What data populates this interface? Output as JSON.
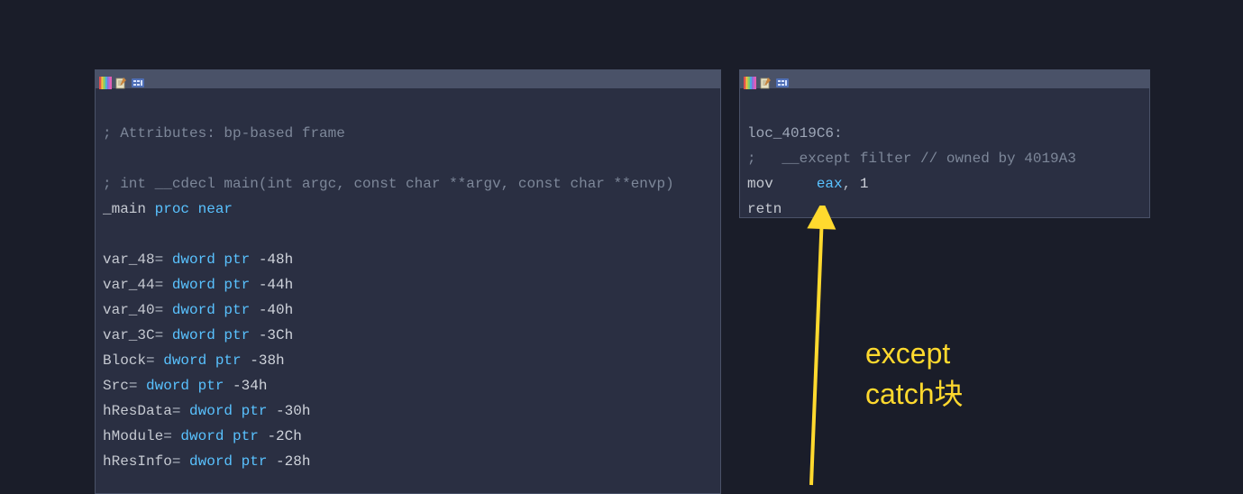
{
  "left_panel": {
    "lines": [
      [
        {
          "cls": "c-plain",
          "t": ""
        }
      ],
      [
        {
          "cls": "c-comment",
          "t": "; Attributes: bp-based frame"
        }
      ],
      [
        {
          "cls": "c-plain",
          "t": ""
        }
      ],
      [
        {
          "cls": "c-comment",
          "t": "; int __cdecl main(int argc, const char **argv, const char **envp)"
        }
      ],
      [
        {
          "cls": "c-id",
          "t": "_main "
        },
        {
          "cls": "c-type",
          "t": "proc near"
        }
      ],
      [
        {
          "cls": "c-plain",
          "t": ""
        }
      ],
      [
        {
          "cls": "c-id",
          "t": "var_48"
        },
        {
          "cls": "c-plain",
          "t": "= "
        },
        {
          "cls": "c-type",
          "t": "dword ptr "
        },
        {
          "cls": "c-num",
          "t": "-48h"
        }
      ],
      [
        {
          "cls": "c-id",
          "t": "var_44"
        },
        {
          "cls": "c-plain",
          "t": "= "
        },
        {
          "cls": "c-type",
          "t": "dword ptr "
        },
        {
          "cls": "c-num",
          "t": "-44h"
        }
      ],
      [
        {
          "cls": "c-id",
          "t": "var_40"
        },
        {
          "cls": "c-plain",
          "t": "= "
        },
        {
          "cls": "c-type",
          "t": "dword ptr "
        },
        {
          "cls": "c-num",
          "t": "-40h"
        }
      ],
      [
        {
          "cls": "c-id",
          "t": "var_3C"
        },
        {
          "cls": "c-plain",
          "t": "= "
        },
        {
          "cls": "c-type",
          "t": "dword ptr "
        },
        {
          "cls": "c-num",
          "t": "-3Ch"
        }
      ],
      [
        {
          "cls": "c-id",
          "t": "Block"
        },
        {
          "cls": "c-plain",
          "t": "= "
        },
        {
          "cls": "c-type",
          "t": "dword ptr "
        },
        {
          "cls": "c-num",
          "t": "-38h"
        }
      ],
      [
        {
          "cls": "c-id",
          "t": "Src"
        },
        {
          "cls": "c-plain",
          "t": "= "
        },
        {
          "cls": "c-type",
          "t": "dword ptr "
        },
        {
          "cls": "c-num",
          "t": "-34h"
        }
      ],
      [
        {
          "cls": "c-id",
          "t": "hResData"
        },
        {
          "cls": "c-plain",
          "t": "= "
        },
        {
          "cls": "c-type",
          "t": "dword ptr "
        },
        {
          "cls": "c-num",
          "t": "-30h"
        }
      ],
      [
        {
          "cls": "c-id",
          "t": "hModule"
        },
        {
          "cls": "c-plain",
          "t": "= "
        },
        {
          "cls": "c-type",
          "t": "dword ptr "
        },
        {
          "cls": "c-num",
          "t": "-2Ch"
        }
      ],
      [
        {
          "cls": "c-id",
          "t": "hResInfo"
        },
        {
          "cls": "c-plain",
          "t": "= "
        },
        {
          "cls": "c-type",
          "t": "dword ptr "
        },
        {
          "cls": "c-num",
          "t": "-28h"
        }
      ]
    ]
  },
  "right_panel": {
    "lines": [
      [
        {
          "cls": "c-plain",
          "t": ""
        }
      ],
      [
        {
          "cls": "c-lbl",
          "t": "loc_4019C6:"
        }
      ],
      [
        {
          "cls": "c-comment",
          "t": ";   __except filter // owned by 4019A3"
        }
      ],
      [
        {
          "cls": "c-id",
          "t": "mov     "
        },
        {
          "cls": "c-reg",
          "t": "eax"
        },
        {
          "cls": "c-plain",
          "t": ", "
        },
        {
          "cls": "c-num",
          "t": "1"
        }
      ],
      [
        {
          "cls": "c-id",
          "t": "retn"
        }
      ]
    ]
  },
  "annotation": {
    "line1": "except",
    "line2": "catch块"
  },
  "icons": {
    "stripes": "color-stripes-icon",
    "paper": "paper-pencil-icon",
    "chip": "hex-bytes-icon"
  }
}
